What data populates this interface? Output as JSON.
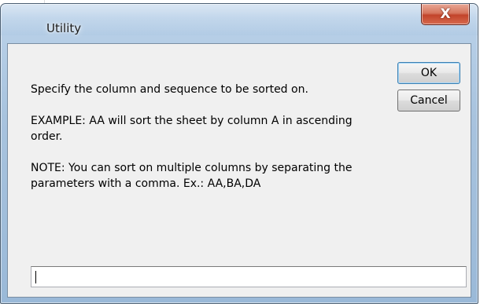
{
  "window": {
    "title": "Utility"
  },
  "title_bar": {
    "close_glyph": "X"
  },
  "prompt": {
    "line_1": "Specify the column and sequence to be sorted on.",
    "line_2": "EXAMPLE: AA will sort the sheet by column A in ascending order.",
    "line_3": "NOTE: You can sort on multiple columns by separating the parameters with a comma. Ex.: AA,BA,DA"
  },
  "buttons": {
    "ok_label": "OK",
    "cancel_label": "Cancel"
  },
  "input": {
    "value": ""
  },
  "colors": {
    "titlebar": "#a8c3de",
    "close_button": "#c2442b",
    "client_background": "#f0f0f0",
    "default_button_border": "#3c7fb1"
  },
  "icons": {
    "close": "close-icon"
  }
}
